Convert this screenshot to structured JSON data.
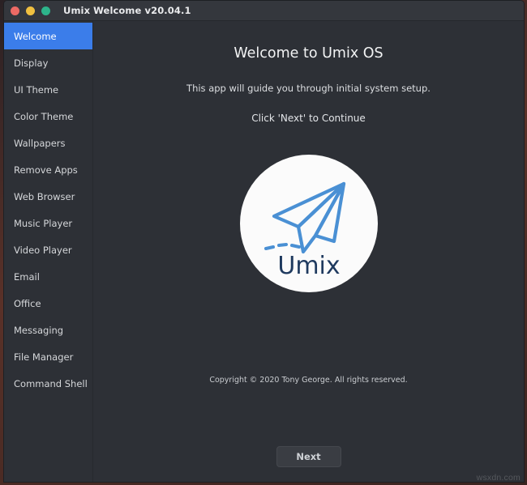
{
  "window": {
    "title": "Umix Welcome v20.04.1",
    "controls": [
      {
        "name": "close",
        "color": "#ec6a65"
      },
      {
        "name": "minimize",
        "color": "#f0c040"
      },
      {
        "name": "maximize",
        "color": "#2db48b"
      }
    ]
  },
  "sidebar": {
    "items": [
      {
        "label": "Welcome",
        "selected": true
      },
      {
        "label": "Display",
        "selected": false
      },
      {
        "label": "UI Theme",
        "selected": false
      },
      {
        "label": "Color Theme",
        "selected": false
      },
      {
        "label": "Wallpapers",
        "selected": false
      },
      {
        "label": "Remove Apps",
        "selected": false
      },
      {
        "label": "Web Browser",
        "selected": false
      },
      {
        "label": "Music Player",
        "selected": false
      },
      {
        "label": "Video Player",
        "selected": false
      },
      {
        "label": "Email",
        "selected": false
      },
      {
        "label": "Office",
        "selected": false
      },
      {
        "label": "Messaging",
        "selected": false
      },
      {
        "label": "File Manager",
        "selected": false
      },
      {
        "label": "Command Shell",
        "selected": false
      }
    ],
    "selected_color": "#3b7dea"
  },
  "main": {
    "heading": "Welcome to Umix OS",
    "description": "This app will guide you through initial system setup.",
    "instruction": "Click 'Next' to Continue",
    "logo": {
      "name": "umix-paper-plane-logo",
      "wordmark": "Umix",
      "plane_color": "#4a90d4",
      "wordmark_color": "#1f3a5f",
      "disc_color": "#fbfbfb"
    },
    "copyright": "Copyright © 2020 Tony George. All rights reserved.",
    "next_label": "Next"
  },
  "overlay": {
    "watermark": "wsxdn.com"
  }
}
